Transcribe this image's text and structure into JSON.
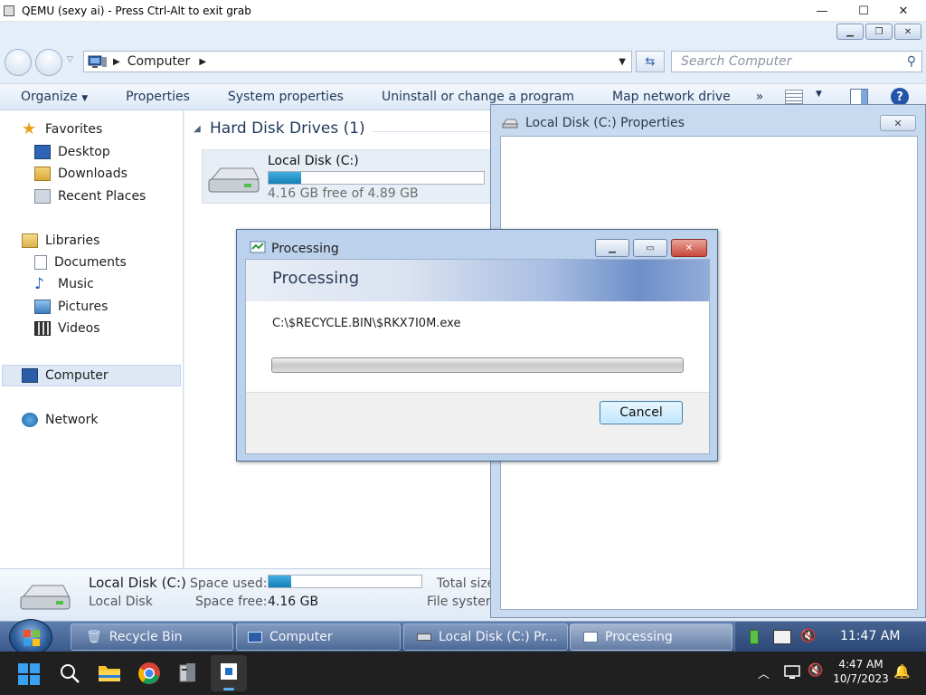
{
  "host": {
    "window_title": "QEMU (sexy ai) - Press Ctrl-Alt to exit grab",
    "controls": [
      "—",
      "☐",
      "✕"
    ],
    "taskbar": {
      "time": "4:47 AM",
      "date": "10/7/2023"
    }
  },
  "explorer": {
    "address_location": "Computer",
    "search_placeholder": "Search Computer",
    "toolbar": {
      "organize": "Organize",
      "properties": "Properties",
      "system_properties": "System properties",
      "uninstall": "Uninstall or change a program",
      "map_drive": "Map network drive",
      "more": "»"
    },
    "sidebar": {
      "favorites": "Favorites",
      "desktop": "Desktop",
      "downloads": "Downloads",
      "recent": "Recent Places",
      "libraries": "Libraries",
      "documents": "Documents",
      "music": "Music",
      "pictures": "Pictures",
      "videos": "Videos",
      "computer": "Computer",
      "network": "Network"
    },
    "group_header": "Hard Disk Drives (1)",
    "drive": {
      "name": "Local Disk (C:)",
      "free_text": "4.16 GB free of 4.89 GB",
      "used_fraction": 0.15
    },
    "details": {
      "name": "Local Disk (C:)",
      "type": "Local Disk",
      "space_used_label": "Space used:",
      "space_free_label": "Space free:",
      "space_free_value": "4.16 GB",
      "total_label": "Total size",
      "fs_label": "File system"
    }
  },
  "properties_window": {
    "title": "Local Disk (C:) Properties"
  },
  "processing_dialog": {
    "title": "Processing",
    "heading": "Processing",
    "path": "C:\\$RECYCLE.BIN\\$RKX7I0M.exe",
    "cancel": "Cancel",
    "progress_fraction": 0.0
  },
  "guest_taskbar": {
    "items": [
      "Recycle Bin",
      "Computer",
      "Local Disk (C:) Pr...",
      "Processing"
    ],
    "clock": "11:47 AM"
  },
  "colors": {
    "accent": "#1e395b",
    "progress_fill": "#1c8fc6",
    "close_red": "#c9483c"
  }
}
